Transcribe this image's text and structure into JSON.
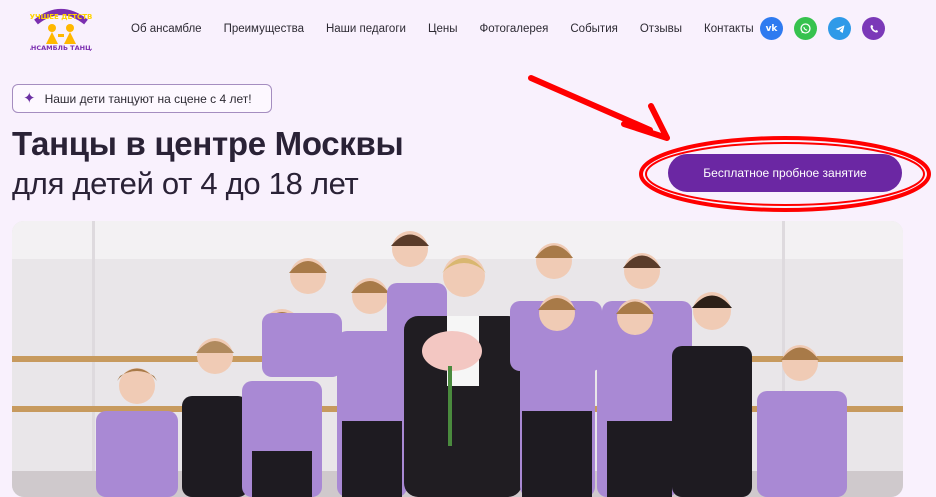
{
  "nav": {
    "items": [
      "Об ансамбле",
      "Преимущества",
      "Наши педагоги",
      "Цены",
      "Фотогалерея",
      "События",
      "Отзывы",
      "Контакты"
    ]
  },
  "socials": [
    {
      "name": "vk-icon",
      "label": "vk",
      "color": "#2f7bf0"
    },
    {
      "name": "whatsapp-icon",
      "label": "",
      "color": "#36c24e"
    },
    {
      "name": "telegram-icon",
      "label": "",
      "color": "#2f9ae8"
    },
    {
      "name": "viber-icon",
      "label": "",
      "color": "#7b39b8"
    }
  ],
  "hero": {
    "badge": "Наши дети танцуют на сцене с 4 лет!",
    "title_line1": "Танцы в центре Москвы",
    "title_line2": "для детей от 4 до 18 лет",
    "cta_label": "Бесплатное пробное занятие"
  },
  "colors": {
    "accent": "#6b27a3",
    "annotation": "#ff0000",
    "background": "#f9f1fd"
  }
}
